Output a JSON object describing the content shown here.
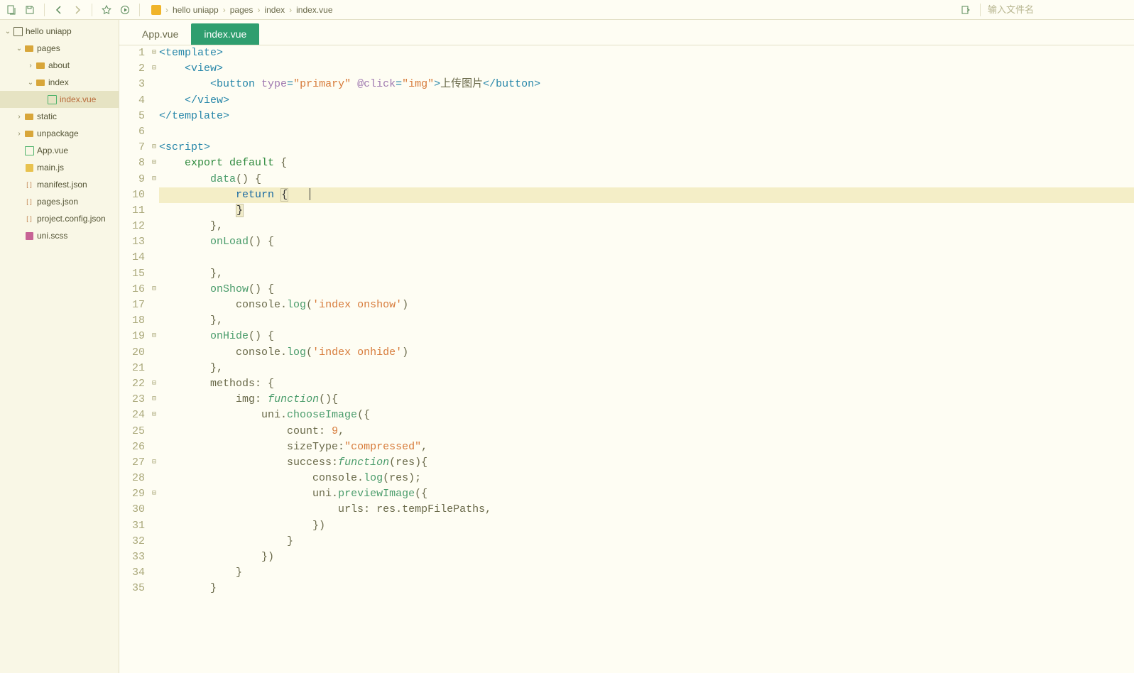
{
  "toolbar": {
    "breadcrumbs": [
      "hello uniapp",
      "pages",
      "index",
      "index.vue"
    ],
    "search_placeholder": "输入文件名"
  },
  "sidebar": {
    "items": [
      {
        "label": "hello uniapp",
        "depth": 0,
        "icon": "proj",
        "caret": "down"
      },
      {
        "label": "pages",
        "depth": 1,
        "icon": "folder",
        "caret": "down"
      },
      {
        "label": "about",
        "depth": 2,
        "icon": "folder",
        "caret": "right"
      },
      {
        "label": "index",
        "depth": 2,
        "icon": "folder",
        "caret": "down"
      },
      {
        "label": "index.vue",
        "depth": 3,
        "icon": "vue",
        "caret": "",
        "selected": true
      },
      {
        "label": "static",
        "depth": 1,
        "icon": "folder",
        "caret": "right"
      },
      {
        "label": "unpackage",
        "depth": 1,
        "icon": "folder",
        "caret": "right"
      },
      {
        "label": "App.vue",
        "depth": 1,
        "icon": "vue",
        "caret": ""
      },
      {
        "label": "main.js",
        "depth": 1,
        "icon": "js",
        "caret": ""
      },
      {
        "label": "manifest.json",
        "depth": 1,
        "icon": "json",
        "caret": ""
      },
      {
        "label": "pages.json",
        "depth": 1,
        "icon": "json",
        "caret": ""
      },
      {
        "label": "project.config.json",
        "depth": 1,
        "icon": "json",
        "caret": ""
      },
      {
        "label": "uni.scss",
        "depth": 1,
        "icon": "scss",
        "caret": ""
      }
    ]
  },
  "tabs": [
    {
      "label": "App.vue",
      "active": false
    },
    {
      "label": "index.vue",
      "active": true
    }
  ],
  "editor": {
    "active_file": "index.vue",
    "current_line": 10,
    "fold_markers": {
      "1": "⊟",
      "2": "⊟",
      "7": "⊟",
      "8": "⊟",
      "9": "⊟",
      "16": "⊟",
      "19": "⊟",
      "22": "⊟",
      "23": "⊟",
      "24": "⊟",
      "27": "⊟",
      "29": "⊟"
    },
    "code": {
      "l1": {
        "tokens": [
          [
            "tag",
            "<template>"
          ]
        ]
      },
      "l2": {
        "indent": 4,
        "tokens": [
          [
            "tag",
            "<view>"
          ]
        ]
      },
      "l3": {
        "indent": 8,
        "tokens": [
          [
            "tag",
            "<button "
          ],
          [
            "attr",
            "type"
          ],
          [
            "tag",
            "="
          ],
          [
            "str",
            "\"primary\""
          ],
          [
            "tag",
            " "
          ],
          [
            "attr",
            "@click"
          ],
          [
            "tag",
            "="
          ],
          [
            "str",
            "\"img\""
          ],
          [
            "tag",
            ">"
          ],
          [
            "plain",
            "上传图片"
          ],
          [
            "tag",
            "</button>"
          ]
        ]
      },
      "l4": {
        "indent": 4,
        "tokens": [
          [
            "tag",
            "</view>"
          ]
        ]
      },
      "l5": {
        "tokens": [
          [
            "tag",
            "</template>"
          ]
        ]
      },
      "l6": {
        "tokens": []
      },
      "l7": {
        "tokens": [
          [
            "tag",
            "<script>"
          ]
        ]
      },
      "l8": {
        "indent": 4,
        "tokens": [
          [
            "kw",
            "export"
          ],
          [
            "plain",
            " "
          ],
          [
            "kw",
            "default"
          ],
          [
            "plain",
            " {"
          ]
        ]
      },
      "l9": {
        "indent": 8,
        "tokens": [
          [
            "call",
            "data"
          ],
          [
            "plain",
            "() {"
          ]
        ]
      },
      "l10": {
        "indent": 12,
        "hl": true,
        "tokens": [
          [
            "kw2",
            "return"
          ],
          [
            "plain",
            " "
          ],
          [
            "bm",
            "{"
          ]
        ],
        "cursor": true
      },
      "l11": {
        "indent": 12,
        "tokens": [
          [
            "bm",
            "}"
          ]
        ]
      },
      "l12": {
        "indent": 8,
        "tokens": [
          [
            "plain",
            "},"
          ]
        ]
      },
      "l13": {
        "indent": 8,
        "tokens": [
          [
            "call",
            "onLoad"
          ],
          [
            "plain",
            "() {"
          ]
        ]
      },
      "l14": {
        "indent": 8,
        "tokens": []
      },
      "l15": {
        "indent": 8,
        "tokens": [
          [
            "plain",
            "},"
          ]
        ]
      },
      "l16": {
        "indent": 8,
        "tokens": [
          [
            "call",
            "onShow"
          ],
          [
            "plain",
            "() {"
          ]
        ]
      },
      "l17": {
        "indent": 12,
        "tokens": [
          [
            "plain",
            "console."
          ],
          [
            "call",
            "log"
          ],
          [
            "plain",
            "("
          ],
          [
            "str",
            "'index onshow'"
          ],
          [
            "plain",
            ")"
          ]
        ]
      },
      "l18": {
        "indent": 8,
        "tokens": [
          [
            "plain",
            "},"
          ]
        ]
      },
      "l19": {
        "indent": 8,
        "tokens": [
          [
            "call",
            "onHide"
          ],
          [
            "plain",
            "() {"
          ]
        ]
      },
      "l20": {
        "indent": 12,
        "tokens": [
          [
            "plain",
            "console."
          ],
          [
            "call",
            "log"
          ],
          [
            "plain",
            "("
          ],
          [
            "str",
            "'index onhide'"
          ],
          [
            "plain",
            ")"
          ]
        ]
      },
      "l21": {
        "indent": 8,
        "tokens": [
          [
            "plain",
            "},"
          ]
        ]
      },
      "l22": {
        "indent": 8,
        "tokens": [
          [
            "plain",
            "methods"
          ],
          [
            "punct",
            ":"
          ],
          [
            "plain",
            " {"
          ]
        ]
      },
      "l23": {
        "indent": 12,
        "tokens": [
          [
            "plain",
            "img"
          ],
          [
            "punct",
            ":"
          ],
          [
            "plain",
            " "
          ],
          [
            "fn",
            "function"
          ],
          [
            "plain",
            "(){"
          ]
        ]
      },
      "l24": {
        "indent": 16,
        "tokens": [
          [
            "plain",
            "uni."
          ],
          [
            "call",
            "chooseImage"
          ],
          [
            "plain",
            "({"
          ]
        ]
      },
      "l25": {
        "indent": 20,
        "tokens": [
          [
            "plain",
            "count"
          ],
          [
            "punct",
            ":"
          ],
          [
            "plain",
            " "
          ],
          [
            "num",
            "9"
          ],
          [
            "plain",
            ","
          ]
        ]
      },
      "l26": {
        "indent": 20,
        "tokens": [
          [
            "plain",
            "sizeType"
          ],
          [
            "punct",
            ":"
          ],
          [
            "str",
            "\"compressed\""
          ],
          [
            "plain",
            ","
          ]
        ]
      },
      "l27": {
        "indent": 20,
        "tokens": [
          [
            "plain",
            "success"
          ],
          [
            "punct",
            ":"
          ],
          [
            "fn",
            "function"
          ],
          [
            "plain",
            "(res){"
          ]
        ]
      },
      "l28": {
        "indent": 24,
        "tokens": [
          [
            "plain",
            "console."
          ],
          [
            "call",
            "log"
          ],
          [
            "plain",
            "(res);"
          ]
        ]
      },
      "l29": {
        "indent": 24,
        "tokens": [
          [
            "plain",
            "uni."
          ],
          [
            "call",
            "previewImage"
          ],
          [
            "plain",
            "({"
          ]
        ]
      },
      "l30": {
        "indent": 28,
        "tokens": [
          [
            "plain",
            "urls"
          ],
          [
            "punct",
            ":"
          ],
          [
            "plain",
            " res.tempFilePaths,"
          ]
        ]
      },
      "l31": {
        "indent": 24,
        "tokens": [
          [
            "plain",
            "})"
          ]
        ]
      },
      "l32": {
        "indent": 20,
        "tokens": [
          [
            "plain",
            "}"
          ]
        ]
      },
      "l33": {
        "indent": 16,
        "tokens": [
          [
            "plain",
            "})"
          ]
        ]
      },
      "l34": {
        "indent": 12,
        "tokens": [
          [
            "plain",
            "}"
          ]
        ]
      },
      "l35": {
        "indent": 8,
        "tokens": [
          [
            "plain",
            "}"
          ]
        ]
      }
    },
    "line_count": 35
  }
}
